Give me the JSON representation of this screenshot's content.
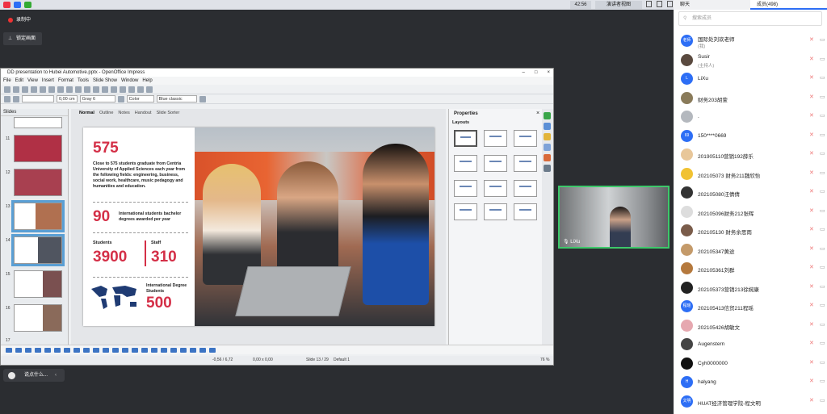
{
  "topbar": {
    "timer": "42:56",
    "view_mode": "演讲者视图"
  },
  "recording": {
    "label": "录制中"
  },
  "lock_screen": {
    "label": "锁定画面"
  },
  "impress": {
    "window_title": "DD presentation to Hubei Automotive.pptx - OpenOffice Impress",
    "menu": [
      "File",
      "Edit",
      "View",
      "Insert",
      "Format",
      "Tools",
      "Slide Show",
      "Window",
      "Help"
    ],
    "toolbar": {
      "line_width": "0,00 cm",
      "line_color": "Gray 6",
      "area_mode": "Color",
      "area_color": "Blue classic"
    },
    "slides_pane_title": "Slides",
    "thumb_numbers": [
      "11",
      "12",
      "13",
      "14",
      "15",
      "16",
      "17"
    ],
    "view_tabs": [
      "Normal",
      "Outline",
      "Notes",
      "Handout",
      "Slide Sorter"
    ],
    "properties": {
      "title": "Properties",
      "section": "Layouts"
    },
    "status": {
      "position": "-0,56 / 6,72",
      "size": "0,00 x 0,00",
      "slide": "Slide 13 / 29",
      "master": "Default 1",
      "zoom": "76 %"
    }
  },
  "slide": {
    "big_num": "575",
    "big_text": "Close to 575 students graduate from Centria University of Applied Sciences each year from the following fields: engineering, business, social work, healthcare, music pedagogy and humanities and education.",
    "intl_num": "90",
    "intl_text": "International students bachelor degrees awarded per year",
    "students_label": "Students",
    "students_num": "3900",
    "staff_label": "Staff",
    "staff_num": "310",
    "degree_label": "International Degree Students",
    "degree_num": "500"
  },
  "chat": {
    "placeholder": "说点什么..."
  },
  "video": {
    "name": "LiXu"
  },
  "panel": {
    "tab_chat": "聊天",
    "tab_members": "成员(498)",
    "search_placeholder": "搜索成员",
    "members": [
      {
        "name": "国际处刘欢老师",
        "sub": "(我)",
        "avatar": "老师",
        "color": "#2d6ef5"
      },
      {
        "name": "Susir",
        "sub": "(主持人)",
        "avatar": "",
        "color": "#5a4a3f"
      },
      {
        "name": "LiXu",
        "sub": "",
        "avatar": "L",
        "color": "#2d6ef5"
      },
      {
        "name": "财务203胡萱",
        "sub": "",
        "avatar": "",
        "color": "#8a7b5a"
      },
      {
        "name": ".",
        "sub": "",
        "avatar": "",
        "color": "#b4b8be"
      },
      {
        "name": "150****0669",
        "sub": "",
        "avatar": "69",
        "color": "#2d6ef5"
      },
      {
        "name": "201905110营销192薛乐",
        "sub": "",
        "avatar": "",
        "color": "#e8c79a"
      },
      {
        "name": "202105073 财务211魏欣怡",
        "sub": "",
        "avatar": "",
        "color": "#f1c232"
      },
      {
        "name": "202105080汪倩倩",
        "sub": "",
        "avatar": "",
        "color": "#333"
      },
      {
        "name": "202105096财务212张晖",
        "sub": "",
        "avatar": "",
        "color": "#ddd"
      },
      {
        "name": "202105130 财务余思雨",
        "sub": "",
        "avatar": "",
        "color": "#7a5c4a"
      },
      {
        "name": "202105347黄途",
        "sub": "",
        "avatar": "",
        "color": "#c49a6a"
      },
      {
        "name": "202105361刘群",
        "sub": "",
        "avatar": "",
        "color": "#b5793d"
      },
      {
        "name": "202105373营销213徐婉康",
        "sub": "",
        "avatar": "",
        "color": "#222"
      },
      {
        "name": "202105413信贸211程瑶",
        "sub": "",
        "avatar": "程瑶",
        "color": "#2d6ef5"
      },
      {
        "name": "202105426胡敏文",
        "sub": "",
        "avatar": "",
        "color": "#e6a8b0"
      },
      {
        "name": "Augenstern",
        "sub": "",
        "avatar": "",
        "color": "#444"
      },
      {
        "name": "Cyh0000000",
        "sub": "",
        "avatar": "",
        "color": "#111"
      },
      {
        "name": "halyang",
        "sub": "",
        "avatar": "H",
        "color": "#2d6ef5"
      },
      {
        "name": "HUAT经济管理学院-程文明",
        "sub": "",
        "avatar": "文明",
        "color": "#2d6ef5"
      }
    ]
  }
}
